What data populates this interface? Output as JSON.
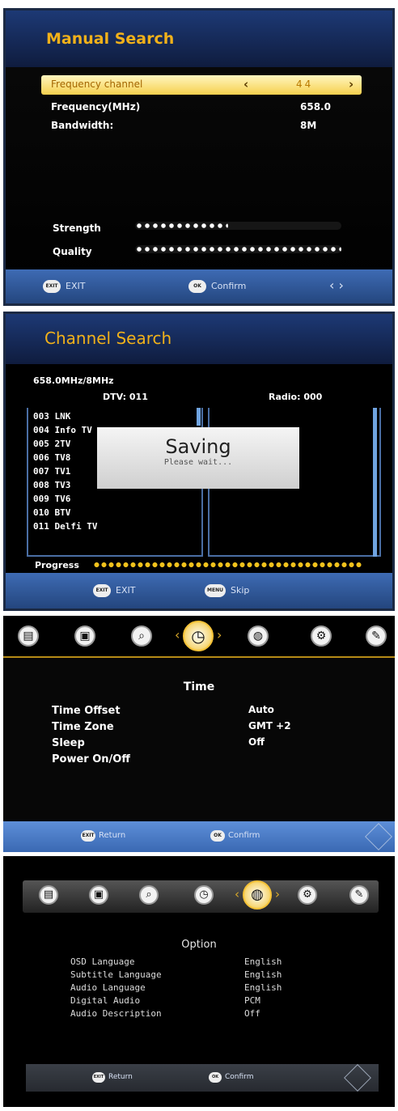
{
  "manual_search": {
    "title": "Manual Search",
    "rows": [
      {
        "label": "Frequency channel",
        "value": "44"
      },
      {
        "label": "Frequency(MHz)",
        "value": "658.0"
      },
      {
        "label": "Bandwidth:",
        "value": "8M"
      }
    ],
    "left_arrow": "‹",
    "right_arrow": "›",
    "strength_label": "Strength",
    "strength_level": 0.45,
    "quality_label": "Quality",
    "quality_level": 1.0,
    "footer": {
      "exit_key": "EXIT",
      "exit_label": "EXIT",
      "confirm_key": "OK",
      "confirm_label": "Confirm",
      "nav": "‹  ›"
    }
  },
  "channel_search": {
    "title": "Channel Search",
    "frequency": "658.0MHz/8MHz",
    "dtv": "DTV: 011",
    "radio": "Radio: 000",
    "channels": [
      "003 LNK",
      "004 Info TV",
      "005 2TV",
      "006 TV8",
      "007 TV1",
      "008 TV3",
      "009 TV6",
      "010 BTV",
      "011 Delfi TV"
    ],
    "dialog_title": "Saving",
    "dialog_text": "Please wait...",
    "progress_label": "Progress",
    "progress": 0.98,
    "footer": {
      "exit_key": "EXIT",
      "exit_label": "EXIT",
      "skip_key": "MENU",
      "skip_label": "Skip"
    }
  },
  "time_menu": {
    "title": "Time",
    "rows": [
      {
        "label": "Time Offset",
        "value": "Auto"
      },
      {
        "label": "Time Zone",
        "value": "GMT +2"
      },
      {
        "label": "Sleep",
        "value": "Off"
      },
      {
        "label": "Power On/Off",
        "value": ""
      }
    ],
    "footer": {
      "return_key": "EXIT",
      "return_label": "Return",
      "confirm_key": "OK",
      "confirm_label": "Confirm"
    }
  },
  "option_menu": {
    "title": "Option",
    "rows": [
      {
        "label": "OSD Language",
        "value": "English"
      },
      {
        "label": "Subtitle Language",
        "value": "English"
      },
      {
        "label": "Audio Language",
        "value": "English"
      },
      {
        "label": "Digital Audio",
        "value": "PCM"
      },
      {
        "label": "Audio Description",
        "value": "Off"
      }
    ],
    "footer": {
      "return_key": "EXIT",
      "return_label": "Return",
      "confirm_key": "OK",
      "confirm_label": "Confirm"
    }
  },
  "menu_icons": [
    {
      "name": "channel-icon",
      "glyph": "▤"
    },
    {
      "name": "picture-icon",
      "glyph": "▣"
    },
    {
      "name": "search-icon",
      "glyph": "⌕"
    },
    {
      "name": "clock-icon",
      "glyph": "◷"
    },
    {
      "name": "globe-icon",
      "glyph": "◍"
    },
    {
      "name": "gear-icon",
      "glyph": "⚙"
    },
    {
      "name": "tools-icon",
      "glyph": "✎"
    }
  ],
  "colors": {
    "title_accent": "#f1b11a",
    "footer_blue": "#3e6bb4",
    "highlight": "#f6d04e"
  }
}
